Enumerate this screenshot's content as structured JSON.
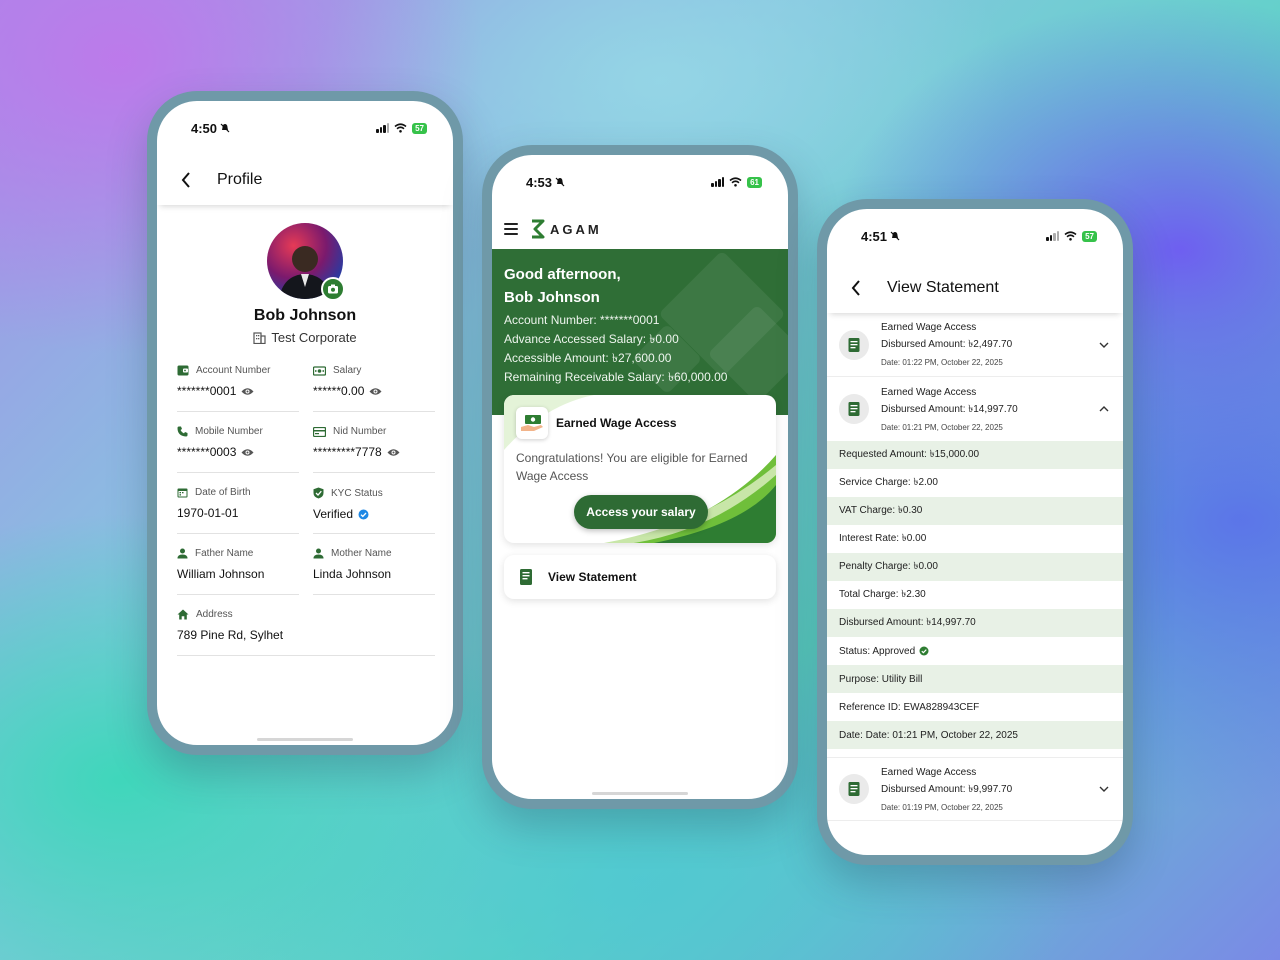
{
  "profile_screen": {
    "status": {
      "time": "4:50",
      "battery": "57"
    },
    "header": {
      "title": "Profile"
    },
    "name": "Bob Johnson",
    "corporate": "Test Corporate",
    "fields": [
      {
        "label": "Account Number",
        "value": "*******0001",
        "icon": "wallet-icon",
        "masked": true
      },
      {
        "label": "Salary",
        "value": "******0.00",
        "icon": "money-icon",
        "masked": true
      },
      {
        "label": "Mobile Number",
        "value": "*******0003",
        "icon": "phone-icon",
        "masked": true
      },
      {
        "label": "Nid Number",
        "value": "*********7778",
        "icon": "id-card-icon",
        "masked": true
      },
      {
        "label": "Date of Birth",
        "value": "1970-01-01",
        "icon": "calendar-icon"
      },
      {
        "label": "KYC Status",
        "value": "Verified",
        "icon": "shield-check-icon",
        "verified": true
      },
      {
        "label": "Father Name",
        "value": "William Johnson",
        "icon": "person-icon"
      },
      {
        "label": "Mother Name",
        "value": "Linda Johnson",
        "icon": "person-icon"
      },
      {
        "label": "Address",
        "value": "789 Pine Rd, Sylhet",
        "icon": "home-icon"
      }
    ]
  },
  "home_screen": {
    "status": {
      "time": "4:53",
      "battery": "61"
    },
    "logo": "AGAM",
    "greeting": "Good afternoon,",
    "user_name": "Bob Johnson",
    "account_number": "Account Number: *******0001",
    "advance_accessed": "Advance Accessed Salary: ৳0.00",
    "accessible_amount": "Accessible Amount: ৳27,600.00",
    "remaining_receivable": "Remaining Receivable Salary: ৳60,000.00",
    "ewa_card": {
      "title": "Earned Wage Access",
      "message": "Congratulations! You are eligible for Earned Wage Access",
      "button": "Access your salary"
    },
    "view_statement": "View Statement"
  },
  "statement_screen": {
    "status": {
      "time": "4:51",
      "battery": "57"
    },
    "header": {
      "title": "View Statement"
    },
    "transactions": [
      {
        "type": "Earned Wage Access",
        "amount": "Disbursed Amount: ৳2,497.70",
        "date": "Date: 01:22 PM, October 22, 2025",
        "expanded": false
      },
      {
        "type": "Earned Wage Access",
        "amount": "Disbursed Amount: ৳14,997.70",
        "date": "Date: 01:21 PM, October 22, 2025",
        "expanded": true
      },
      {
        "type": "Earned Wage Access",
        "amount": "Disbursed Amount: ৳9,997.70",
        "date": "Date: 01:19 PM, October 22, 2025",
        "expanded": false
      }
    ],
    "details": [
      "Requested Amount: ৳15,000.00",
      "Service Charge: ৳2.00",
      "VAT Charge: ৳0.30",
      "Interest Rate: ৳0.00",
      "Penalty Charge: ৳0.00",
      "Total Charge: ৳2.30",
      "Disbursed Amount: ৳14,997.70",
      "Status: Approved",
      "Purpose: Utility Bill",
      "Reference ID: EWA828943CEF",
      "Date: Date: 01:21 PM, October 22, 2025"
    ]
  },
  "colors": {
    "brand_green": "#2e6b34",
    "hero_green": "#2f6e36",
    "row_alt": "#e8f1e6",
    "verified_blue": "#1e88e5"
  }
}
